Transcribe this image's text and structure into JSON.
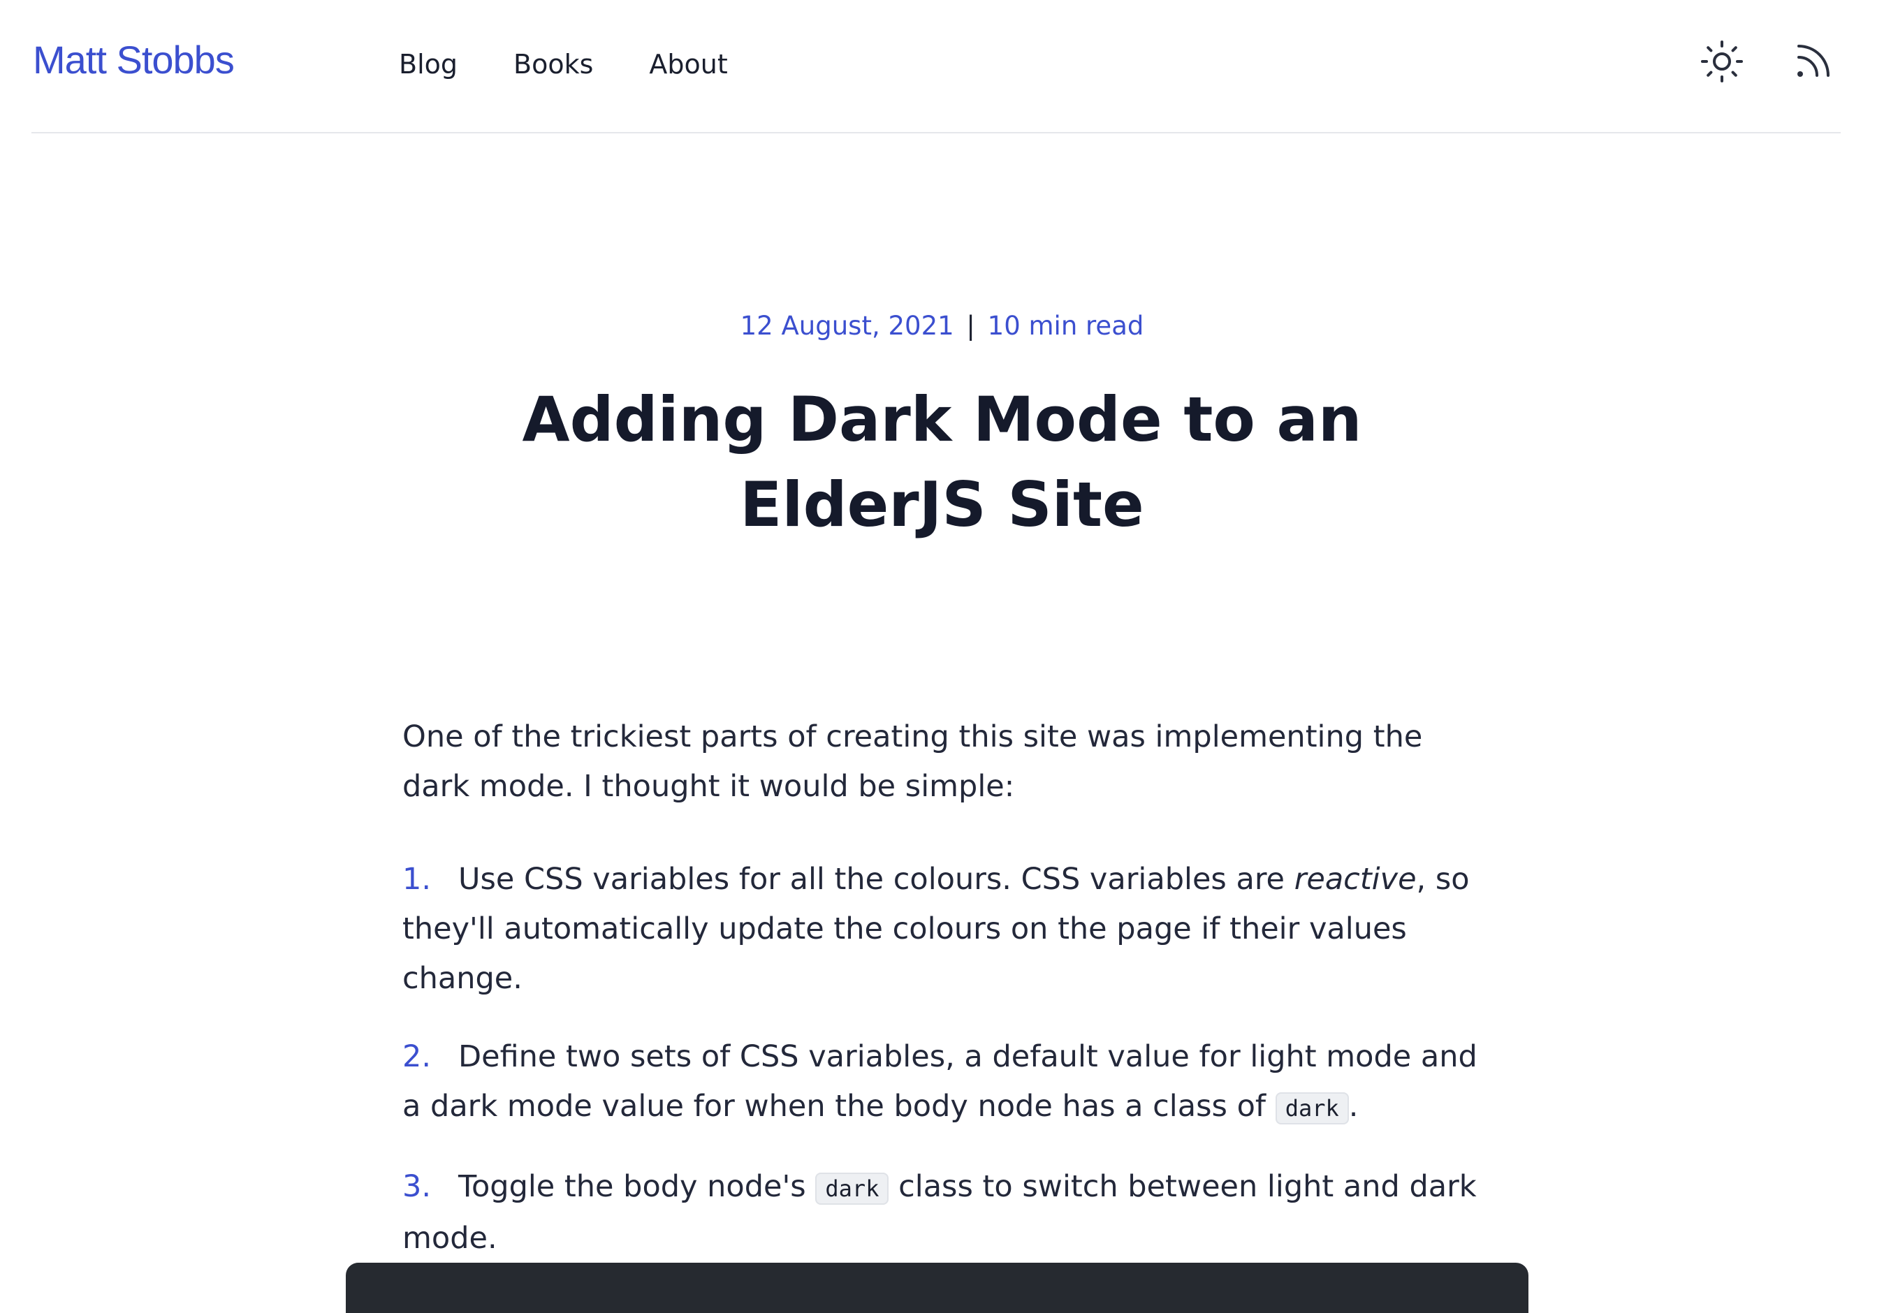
{
  "header": {
    "logo": "Matt Stobbs",
    "nav": [
      "Blog",
      "Books",
      "About"
    ],
    "icons": {
      "theme_toggle": "sun-icon",
      "rss": "rss-icon"
    }
  },
  "article": {
    "date": "12 August, 2021",
    "separator": "|",
    "read_time": "10 min read",
    "title": "Adding Dark Mode to an ElderJS Site",
    "intro": "One of the trickiest parts of creating this site was implementing the dark mode. I thought it would be simple:",
    "steps": [
      {
        "num": "1.",
        "before": "Use CSS variables for all the colours. CSS variables are ",
        "em": "reactive",
        "after": ", so they'll automatically update the colours on the page if their values change."
      },
      {
        "num": "2.",
        "before": "Define two sets of CSS variables, a default value for light mode and a dark mode value for when the body node has a class of ",
        "code": "dark",
        "after": "."
      },
      {
        "num": "3.",
        "before": "Toggle the body node's ",
        "code": "dark",
        "after": " class to switch between light and dark mode."
      }
    ]
  },
  "colors": {
    "accent": "#3b4fcf",
    "text": "#1a1f2e",
    "code_block_bg": "#262a30"
  }
}
